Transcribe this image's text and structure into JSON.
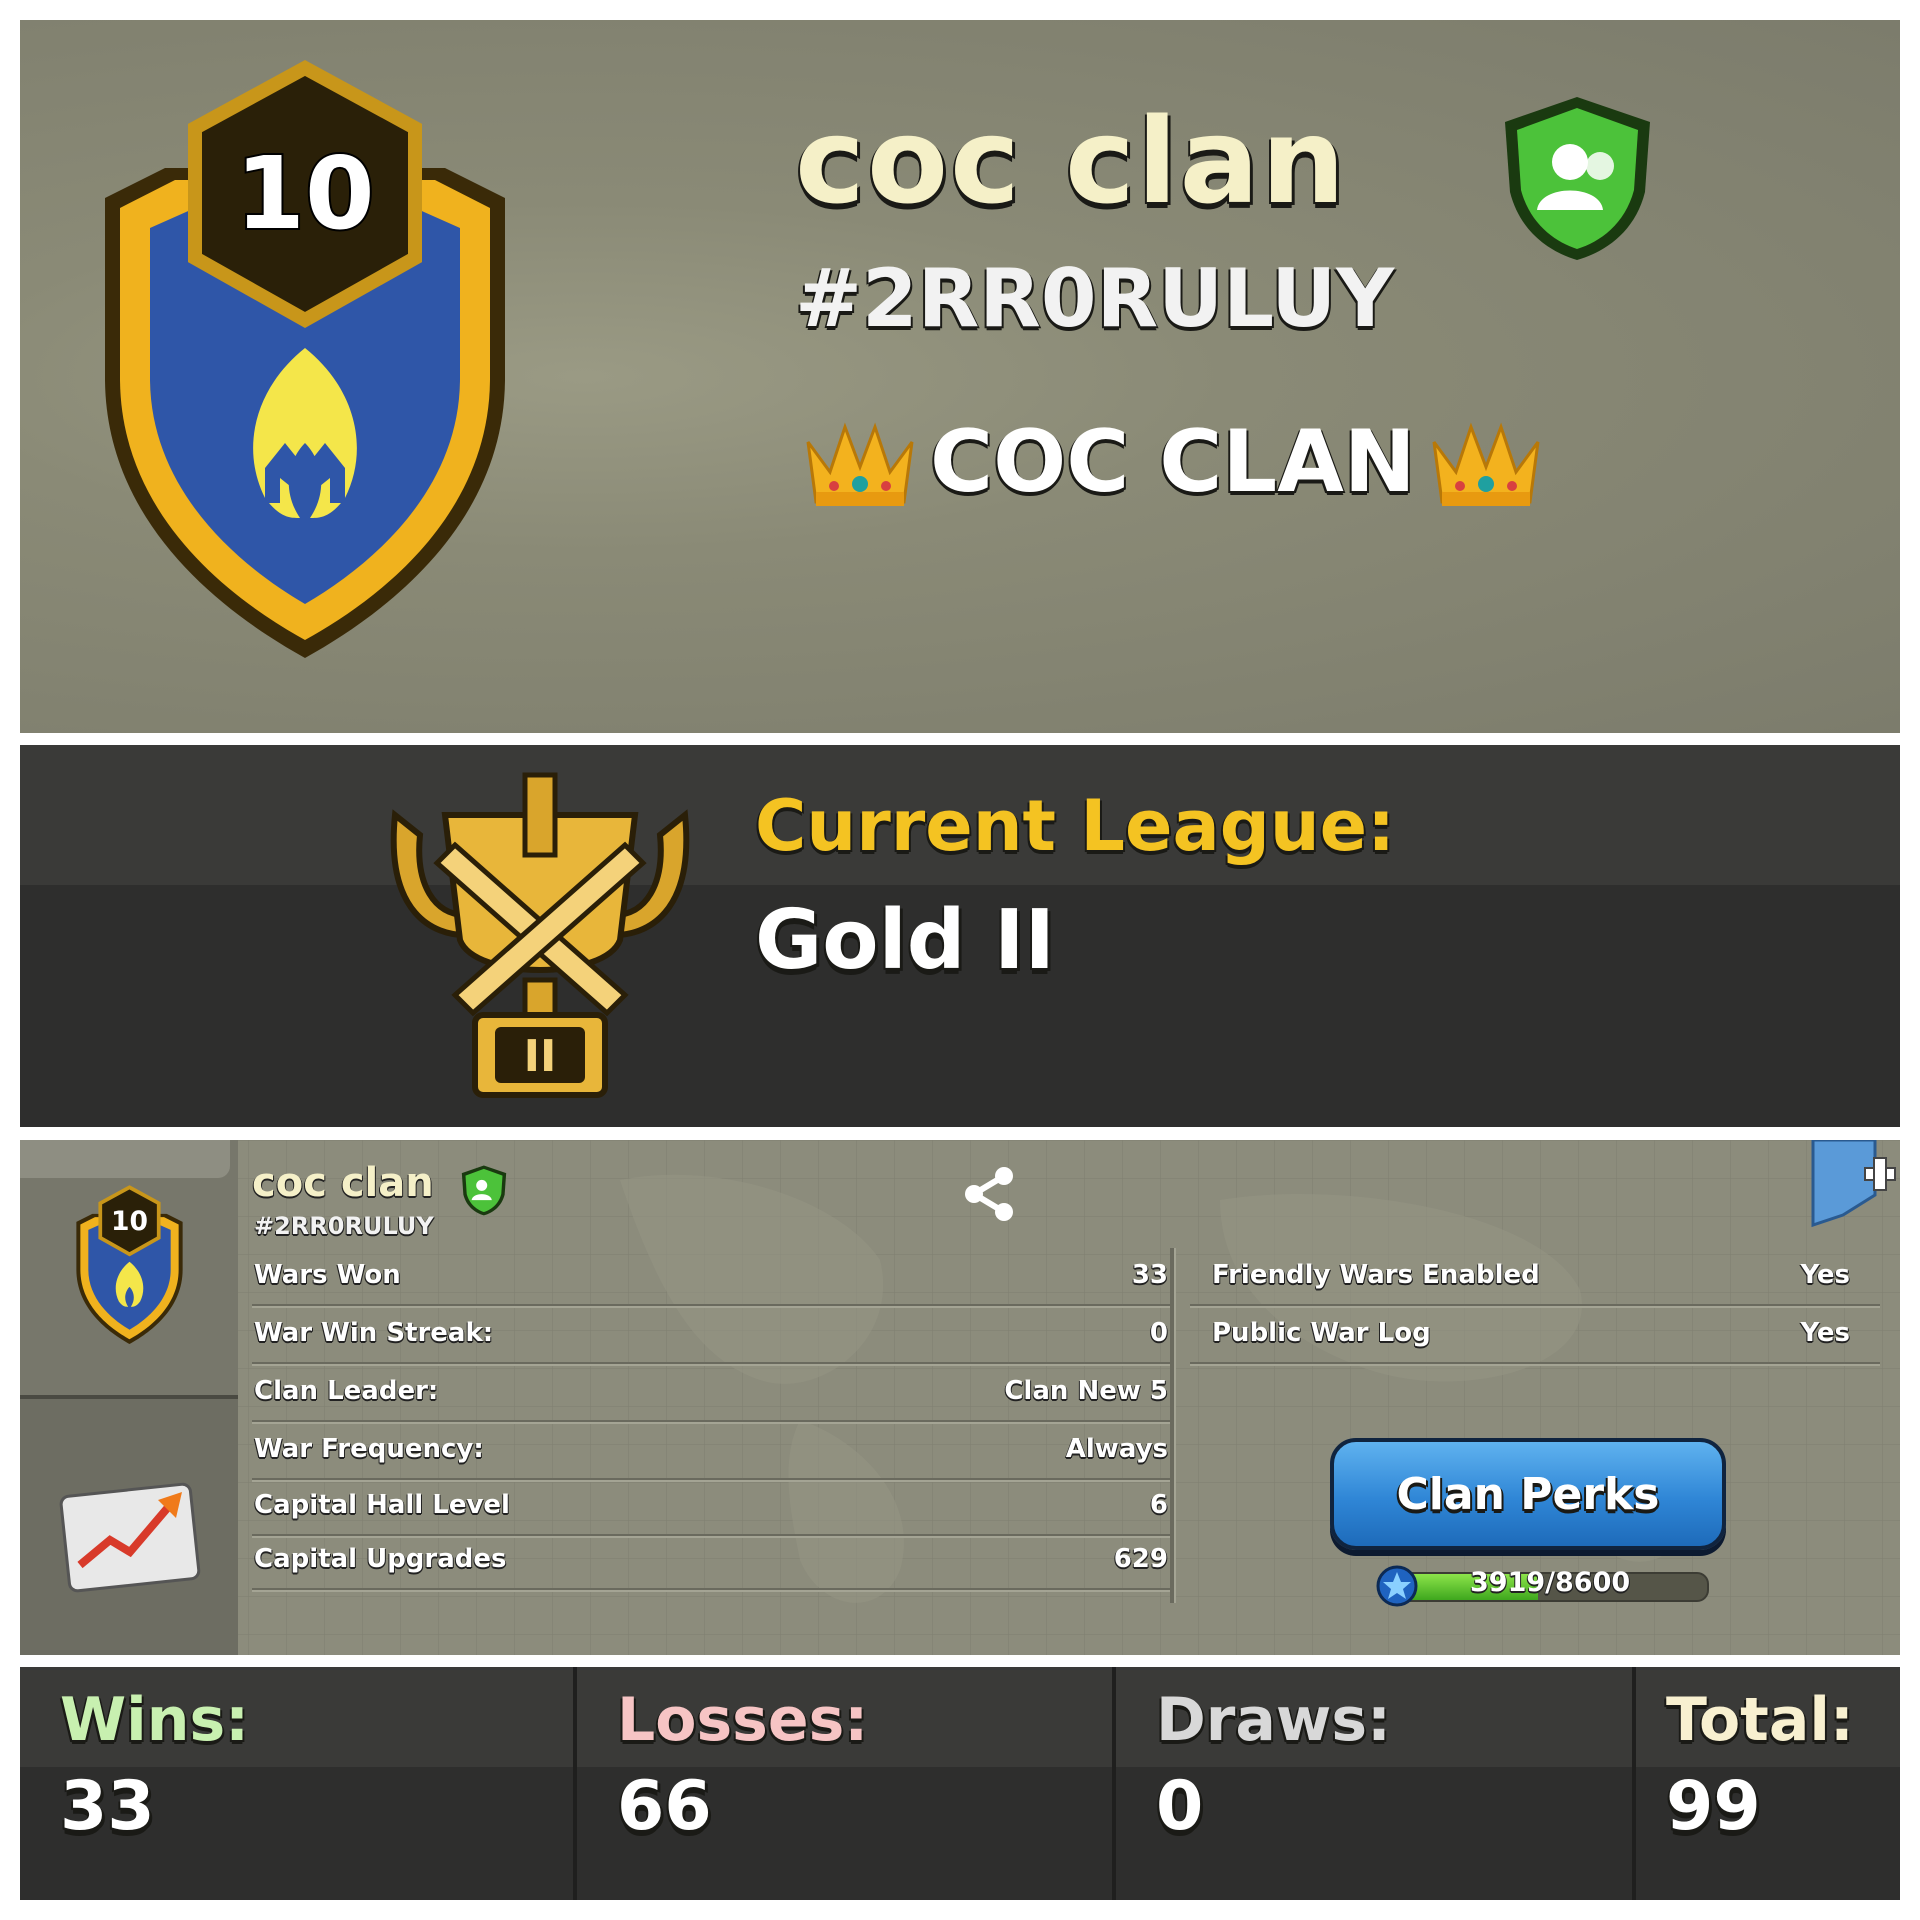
{
  "clan": {
    "name": "coc clan",
    "tag": "#2RR0RULUY",
    "description": "COC CLAN",
    "level": "10"
  },
  "league": {
    "label": "Current League:",
    "name": "Gold II",
    "tier": "II"
  },
  "details": {
    "left_rows": [
      {
        "label": "Wars Won",
        "value": "33"
      },
      {
        "label": "War Win Streak:",
        "value": "0"
      },
      {
        "label": "Clan Leader:",
        "value": "Clan New 5"
      },
      {
        "label": "War Frequency:",
        "value": "Always"
      },
      {
        "label": "Capital Hall Level",
        "value": "6"
      },
      {
        "label": "Capital Upgrades",
        "value": "629"
      }
    ],
    "right_rows": [
      {
        "label": "Friendly Wars Enabled",
        "value": "Yes"
      },
      {
        "label": "Public War Log",
        "value": "Yes"
      }
    ],
    "perks_button": "Clan Perks",
    "perks_progress": "3919/8600",
    "perks_current": 3919,
    "perks_max": 8600
  },
  "record": {
    "wins_label": "Wins:",
    "wins": "33",
    "losses_label": "Losses:",
    "losses": "66",
    "draws_label": "Draws:",
    "draws": "0",
    "total_label": "Total:",
    "total": "99"
  },
  "colors": {
    "league_gold": "#f4c322",
    "wins_green": "#c8f0b0",
    "losses_pink": "#f6c4c4",
    "draws_grey": "#d8d8d8",
    "total_cream": "#f8f0d0",
    "perks_blue": "#2f86d6",
    "badge_blue": "#2f56a8",
    "badge_gold": "#f0b21e"
  },
  "icons": [
    "clan-badge-icon",
    "verified-shield-icon",
    "crown-icon",
    "league-trophy-icon",
    "share-icon",
    "bookmark-add-icon",
    "trend-chart-icon",
    "xp-star-icon"
  ]
}
